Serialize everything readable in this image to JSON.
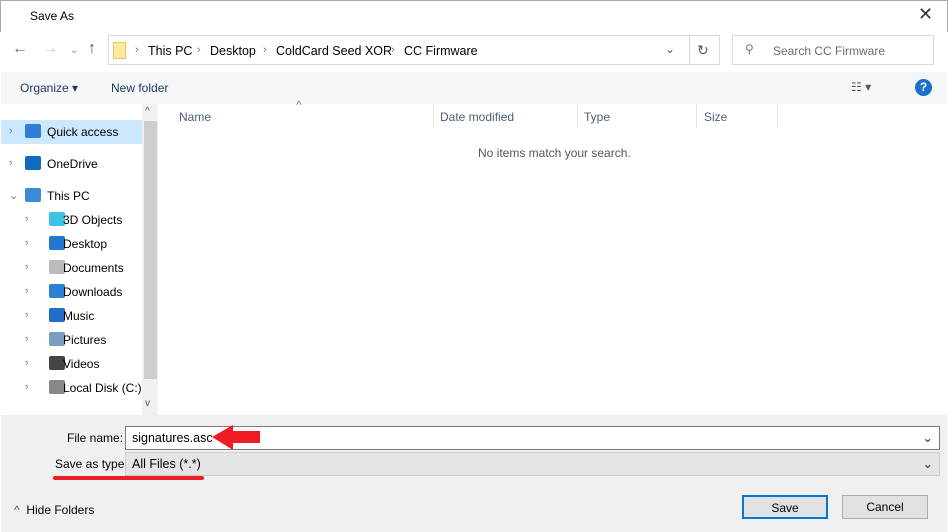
{
  "window": {
    "title": "Save As"
  },
  "address": {
    "crumbs": [
      "This PC",
      "Desktop",
      "ColdCard Seed XOR",
      "CC Firmware"
    ]
  },
  "search": {
    "placeholder": "Search CC Firmware"
  },
  "toolbar": {
    "organize": "Organize",
    "new_folder": "New folder"
  },
  "nav": {
    "items": [
      {
        "label": "Quick access",
        "icon": "star-icon",
        "level": 0,
        "selected": true
      },
      {
        "label": "OneDrive",
        "icon": "cloud-icon",
        "level": 0
      },
      {
        "label": "This PC",
        "icon": "computer-icon",
        "level": 0,
        "expanded": true
      },
      {
        "label": "3D Objects",
        "icon": "cube-icon",
        "level": 1
      },
      {
        "label": "Desktop",
        "icon": "desktop-icon",
        "level": 1
      },
      {
        "label": "Documents",
        "icon": "document-icon",
        "level": 1
      },
      {
        "label": "Downloads",
        "icon": "download-icon",
        "level": 1
      },
      {
        "label": "Music",
        "icon": "music-icon",
        "level": 1
      },
      {
        "label": "Pictures",
        "icon": "picture-icon",
        "level": 1
      },
      {
        "label": "Videos",
        "icon": "video-icon",
        "level": 1
      },
      {
        "label": "Local Disk (C:)",
        "icon": "drive-icon",
        "level": 1
      }
    ]
  },
  "columns": [
    "Name",
    "Date modified",
    "Type",
    "Size"
  ],
  "empty_message": "No items match your search.",
  "form": {
    "file_name_label": "File name:",
    "file_name_value": "signatures.asc",
    "type_label": "Save as type:",
    "type_value": "All Files (*.*)"
  },
  "footer": {
    "hide_folders": "Hide Folders",
    "save": "Save",
    "cancel": "Cancel"
  },
  "colors": {
    "annotation": "#ee1c25",
    "selected": "#cce8ff",
    "accent": "#0078d7"
  }
}
